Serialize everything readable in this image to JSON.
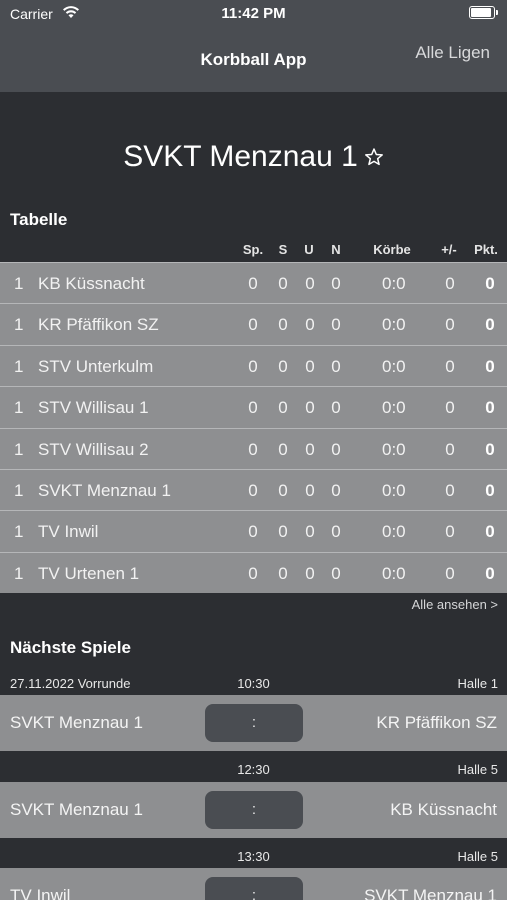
{
  "status_bar": {
    "carrier": "Carrier",
    "time": "11:42 PM"
  },
  "nav": {
    "title": "Korbball App",
    "right_button": "Alle Ligen"
  },
  "team": {
    "name": "SVKT Menznau 1"
  },
  "table": {
    "title": "Tabelle",
    "headers": {
      "games": "Sp.",
      "won": "S",
      "draw": "U",
      "lost": "N",
      "baskets": "Körbe",
      "diff": "+/-",
      "points": "Pkt."
    },
    "rows": [
      {
        "rank": "1",
        "team": "KB Küssnacht",
        "games": "0",
        "won": "0",
        "draw": "0",
        "lost": "0",
        "baskets": "0:0",
        "diff": "0",
        "points": "0"
      },
      {
        "rank": "1",
        "team": "KR Pfäffikon SZ",
        "games": "0",
        "won": "0",
        "draw": "0",
        "lost": "0",
        "baskets": "0:0",
        "diff": "0",
        "points": "0"
      },
      {
        "rank": "1",
        "team": "STV Unterkulm",
        "games": "0",
        "won": "0",
        "draw": "0",
        "lost": "0",
        "baskets": "0:0",
        "diff": "0",
        "points": "0"
      },
      {
        "rank": "1",
        "team": "STV Willisau 1",
        "games": "0",
        "won": "0",
        "draw": "0",
        "lost": "0",
        "baskets": "0:0",
        "diff": "0",
        "points": "0"
      },
      {
        "rank": "1",
        "team": "STV Willisau 2",
        "games": "0",
        "won": "0",
        "draw": "0",
        "lost": "0",
        "baskets": "0:0",
        "diff": "0",
        "points": "0"
      },
      {
        "rank": "1",
        "team": "SVKT Menznau 1",
        "games": "0",
        "won": "0",
        "draw": "0",
        "lost": "0",
        "baskets": "0:0",
        "diff": "0",
        "points": "0"
      },
      {
        "rank": "1",
        "team": "TV Inwil",
        "games": "0",
        "won": "0",
        "draw": "0",
        "lost": "0",
        "baskets": "0:0",
        "diff": "0",
        "points": "0"
      },
      {
        "rank": "1",
        "team": "TV Urtenen 1",
        "games": "0",
        "won": "0",
        "draw": "0",
        "lost": "0",
        "baskets": "0:0",
        "diff": "0",
        "points": "0"
      }
    ],
    "see_all": "Alle ansehen >"
  },
  "games": {
    "title": "Nächste Spiele",
    "items": [
      {
        "date": "27.11.2022 Vorrunde",
        "time": "10:30",
        "hall": "Halle 1",
        "home": "SVKT Menznau 1",
        "score": ":",
        "away": "KR Pfäffikon SZ"
      },
      {
        "date": "",
        "time": "12:30",
        "hall": "Halle 5",
        "home": "SVKT Menznau 1",
        "score": ":",
        "away": "KB Küssnacht"
      },
      {
        "date": "",
        "time": "13:30",
        "hall": "Halle 5",
        "home": "TV Inwil",
        "score": ":",
        "away": "SVKT Menznau 1"
      }
    ]
  }
}
